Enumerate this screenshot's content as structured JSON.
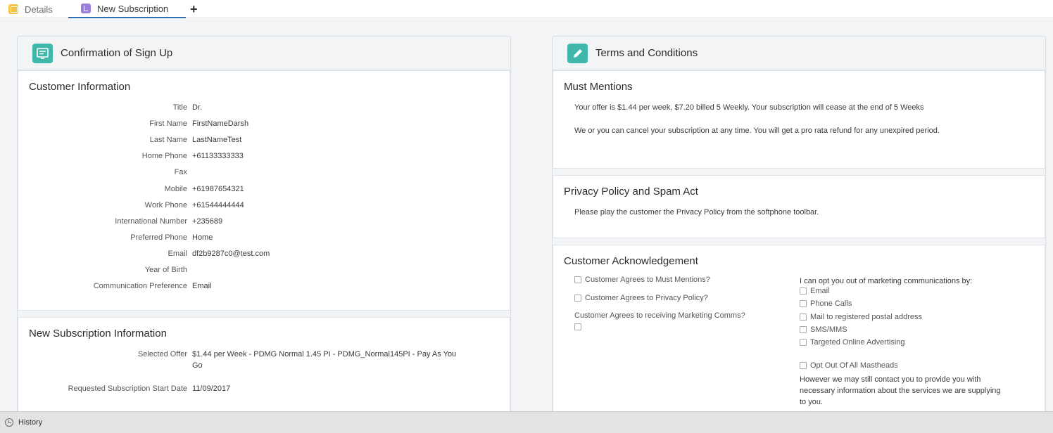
{
  "tabs": [
    {
      "label": "Details",
      "icon": "folder-icon"
    },
    {
      "label": "New Subscription",
      "icon": "subscription-icon"
    }
  ],
  "add_tab_label": "+",
  "left": {
    "header": "Confirmation of Sign Up",
    "customer_info": {
      "title": "Customer Information",
      "fields": [
        {
          "label": "Title",
          "value": "Dr."
        },
        {
          "label": "First Name",
          "value": "FirstNameDarsh"
        },
        {
          "label": "Last Name",
          "value": "LastNameTest"
        },
        {
          "label": "Home Phone",
          "value": "+61133333333"
        },
        {
          "label": "Fax",
          "value": ""
        },
        {
          "label": "Mobile",
          "value": "+61987654321"
        },
        {
          "label": "Work Phone",
          "value": "+61544444444"
        },
        {
          "label": "International Number",
          "value": "+235689"
        },
        {
          "label": "Preferred Phone",
          "value": "Home"
        },
        {
          "label": "Email",
          "value": "df2b9287c0@test.com"
        },
        {
          "label": "Year of Birth",
          "value": ""
        },
        {
          "label": "Communication Preference",
          "value": "Email"
        }
      ]
    },
    "subscription_info": {
      "title": "New Subscription Information",
      "selected_offer_label": "Selected Offer",
      "selected_offer_line1": "$1.44 per Week - PDMG Normal 1.45 PI - PDMG_Normal145PI - Pay As You",
      "selected_offer_line2": "Go",
      "start_date_label": "Requested Subscription Start Date",
      "start_date_value": "11/09/2017"
    }
  },
  "right": {
    "header": "Terms and Conditions",
    "must_mentions": {
      "title": "Must Mentions",
      "line1": "Your offer is $1.44 per week, $7.20 billed 5 Weekly. Your subscription will cease at the end of 5 Weeks",
      "line2": "We or you can cancel your subscription at any time. You will get a pro rata refund for any unexpired period."
    },
    "privacy": {
      "title": "Privacy Policy and Spam Act",
      "text": "Please play the customer the Privacy Policy from the softphone toolbar."
    },
    "ack": {
      "title": "Customer Acknowledgement",
      "agree_mentions": "Customer Agrees to Must Mentions?",
      "agree_privacy": "Customer Agrees to Privacy Policy?",
      "agree_marketing": "Customer Agrees to receiving Marketing Comms?",
      "opt_out_heading": "I can opt you out of marketing communications by:",
      "opt_out_options": [
        "Email",
        "Phone Calls",
        "Mail to registered postal address",
        "SMS/MMS",
        "Targeted Online Advertising"
      ],
      "opt_out_mastheads": "Opt Out Of All Mastheads",
      "disclaimer_line1": "However we may still contact you to provide you with",
      "disclaimer_line2": "necessary information about the services we are supplying",
      "disclaimer_line3": "to you."
    }
  },
  "footer": {
    "label": "History"
  }
}
